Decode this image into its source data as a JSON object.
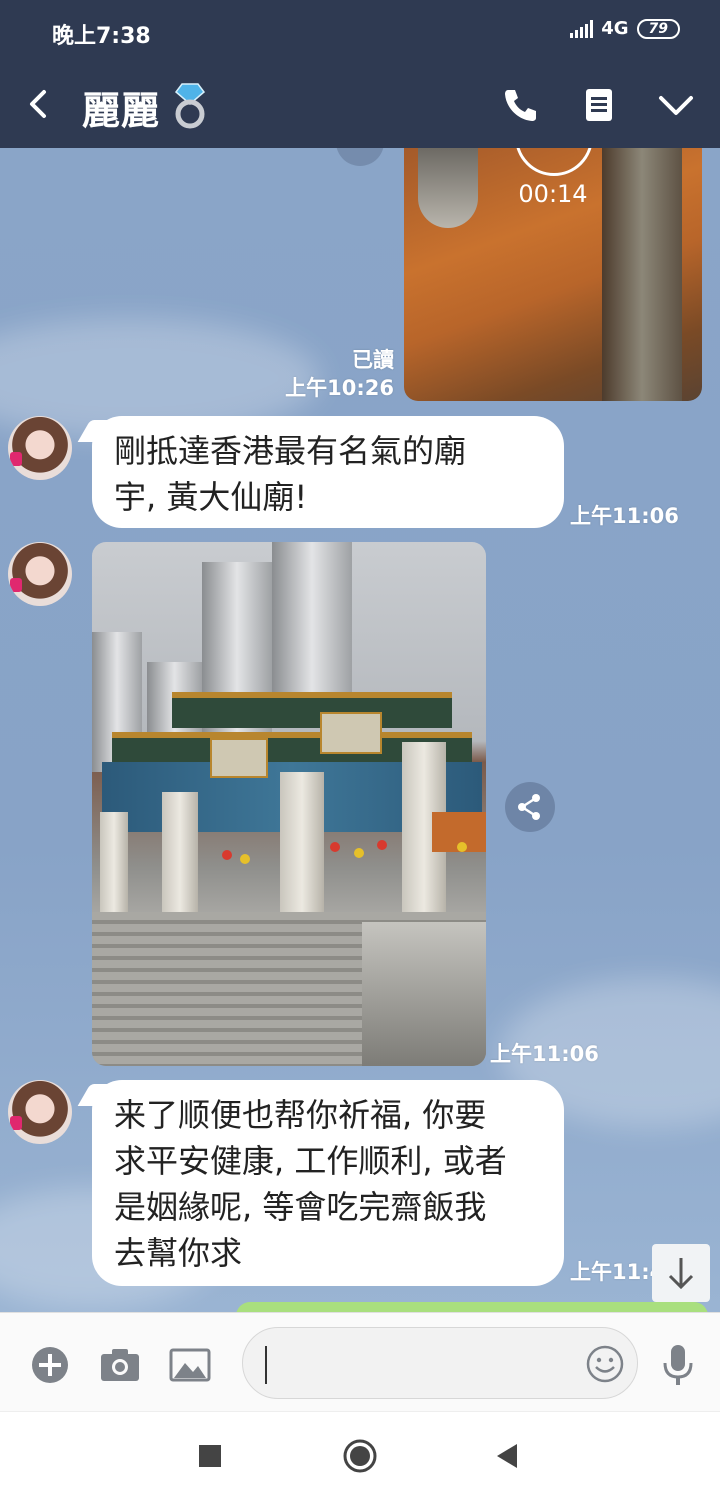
{
  "status_bar": {
    "time": "晚上7:38",
    "network": "4G",
    "battery": "79"
  },
  "header": {
    "contact_name": "麗麗"
  },
  "messages": {
    "video": {
      "duration": "00:14",
      "read_status": "已讀",
      "time": "上午10:26"
    },
    "text1": {
      "line1": "剛抵達香港最有名氣的廟",
      "line2": "宇, 黃大仙廟!",
      "time": "上午11:06"
    },
    "photo": {
      "time": "上午11:06"
    },
    "text2": {
      "line1": "来了顺便也帮你祈福, 你要",
      "line2": "求平安健康, 工作顺利, 或者",
      "line3": "是姻緣呢, 等會吃完齋飯我",
      "line4": "去幫你求",
      "time": "上午11:4"
    }
  },
  "input": {
    "placeholder": ""
  },
  "colors": {
    "header_bg": "#2f3a52",
    "chat_bg": "#8ea7c9",
    "bubble_bg": "#ffffff",
    "accent_green": "#a9df7e"
  }
}
